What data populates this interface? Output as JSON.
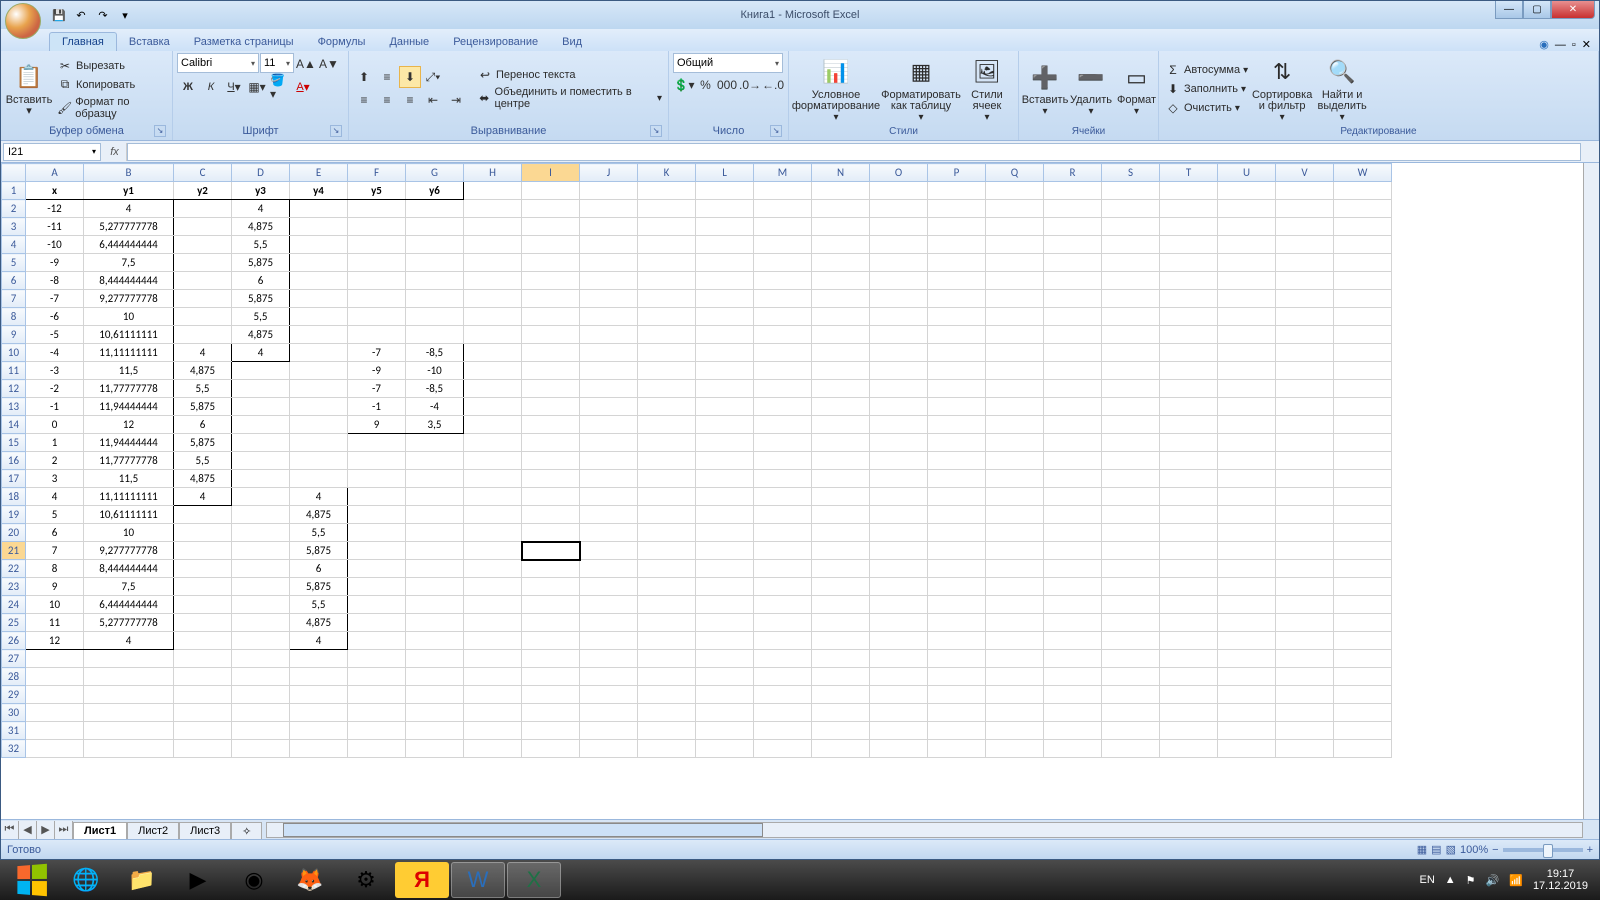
{
  "title": "Книга1 - Microsoft Excel",
  "qat": {
    "save": "💾",
    "undo": "↶",
    "redo": "↷"
  },
  "tabs": [
    "Главная",
    "Вставка",
    "Разметка страницы",
    "Формулы",
    "Данные",
    "Рецензирование",
    "Вид"
  ],
  "activeTab": 0,
  "ribbon": {
    "clipboard": {
      "label": "Буфер обмена",
      "paste": "Вставить",
      "cut": "Вырезать",
      "copy": "Копировать",
      "fmt": "Формат по образцу"
    },
    "font": {
      "label": "Шрифт",
      "name": "Calibri",
      "size": "11"
    },
    "align": {
      "label": "Выравнивание",
      "wrap": "Перенос текста",
      "merge": "Объединить и поместить в центре"
    },
    "number": {
      "label": "Число",
      "format": "Общий"
    },
    "styles": {
      "label": "Стили",
      "cond": "Условное форматирование",
      "fmtTable": "Форматировать как таблицу",
      "cellStyles": "Стили ячеек"
    },
    "cells": {
      "label": "Ячейки",
      "insert": "Вставить",
      "delete": "Удалить",
      "format": "Формат"
    },
    "editing": {
      "label": "Редактирование",
      "autosum": "Автосумма",
      "fill": "Заполнить",
      "clear": "Очистить",
      "sort": "Сортировка и фильтр",
      "find": "Найти и выделить"
    }
  },
  "nameBox": "I21",
  "formula": "",
  "columns": [
    "A",
    "B",
    "C",
    "D",
    "E",
    "F",
    "G",
    "H",
    "I",
    "J",
    "K",
    "L",
    "M",
    "N",
    "O",
    "P",
    "Q",
    "R",
    "S",
    "T",
    "U",
    "V",
    "W"
  ],
  "activeCol": "I",
  "activeRow": 21,
  "rows": 32,
  "headers": {
    "A": "x",
    "B": "y1",
    "C": "y2",
    "D": "y3",
    "E": "y4",
    "F": "y5",
    "G": "y6"
  },
  "cells": {
    "A2": "-12",
    "B2": "4",
    "D2": "4",
    "A3": "-11",
    "B3": "5,277777778",
    "D3": "4,875",
    "A4": "-10",
    "B4": "6,444444444",
    "D4": "5,5",
    "A5": "-9",
    "B5": "7,5",
    "D5": "5,875",
    "A6": "-8",
    "B6": "8,444444444",
    "D6": "6",
    "A7": "-7",
    "B7": "9,277777778",
    "D7": "5,875",
    "A8": "-6",
    "B8": "10",
    "D8": "5,5",
    "A9": "-5",
    "B9": "10,61111111",
    "D9": "4,875",
    "A10": "-4",
    "B10": "11,11111111",
    "C10": "4",
    "D10": "4",
    "F10": "-7",
    "G10": "-8,5",
    "A11": "-3",
    "B11": "11,5",
    "C11": "4,875",
    "F11": "-9",
    "G11": "-10",
    "A12": "-2",
    "B12": "11,77777778",
    "C12": "5,5",
    "F12": "-7",
    "G12": "-8,5",
    "A13": "-1",
    "B13": "11,94444444",
    "C13": "5,875",
    "F13": "-1",
    "G13": "-4",
    "A14": "0",
    "B14": "12",
    "C14": "6",
    "F14": "9",
    "G14": "3,5",
    "A15": "1",
    "B15": "11,94444444",
    "C15": "5,875",
    "A16": "2",
    "B16": "11,77777778",
    "C16": "5,5",
    "A17": "3",
    "B17": "11,5",
    "C17": "4,875",
    "A18": "4",
    "B18": "11,11111111",
    "C18": "4",
    "E18": "4",
    "A19": "5",
    "B19": "10,61111111",
    "E19": "4,875",
    "A20": "6",
    "B20": "10",
    "E20": "5,5",
    "A21": "7",
    "B21": "9,277777778",
    "E21": "5,875",
    "A22": "8",
    "B22": "8,444444444",
    "E22": "6",
    "A23": "9",
    "B23": "7,5",
    "E23": "5,875",
    "A24": "10",
    "B24": "6,444444444",
    "E24": "5,5",
    "A25": "11",
    "B25": "5,277777778",
    "E25": "4,875",
    "A26": "12",
    "B26": "4",
    "E26": "4"
  },
  "boxes": [
    {
      "c1": "A",
      "r1": 1,
      "c2": "G",
      "r2": 1
    },
    {
      "c1": "A",
      "r1": 2,
      "c2": "B",
      "r2": 26
    },
    {
      "c1": "C",
      "r1": 10,
      "c2": "C",
      "r2": 18
    },
    {
      "c1": "D",
      "r1": 2,
      "c2": "D",
      "r2": 10
    },
    {
      "c1": "E",
      "r1": 18,
      "c2": "E",
      "r2": 26
    },
    {
      "c1": "F",
      "r1": 10,
      "c2": "G",
      "r2": 14
    }
  ],
  "sheets": [
    "Лист1",
    "Лист2",
    "Лист3"
  ],
  "activeSheet": 0,
  "status": "Готово",
  "zoom": "100%",
  "tray": {
    "lang": "EN",
    "time": "19:17",
    "date": "17.12.2019"
  }
}
